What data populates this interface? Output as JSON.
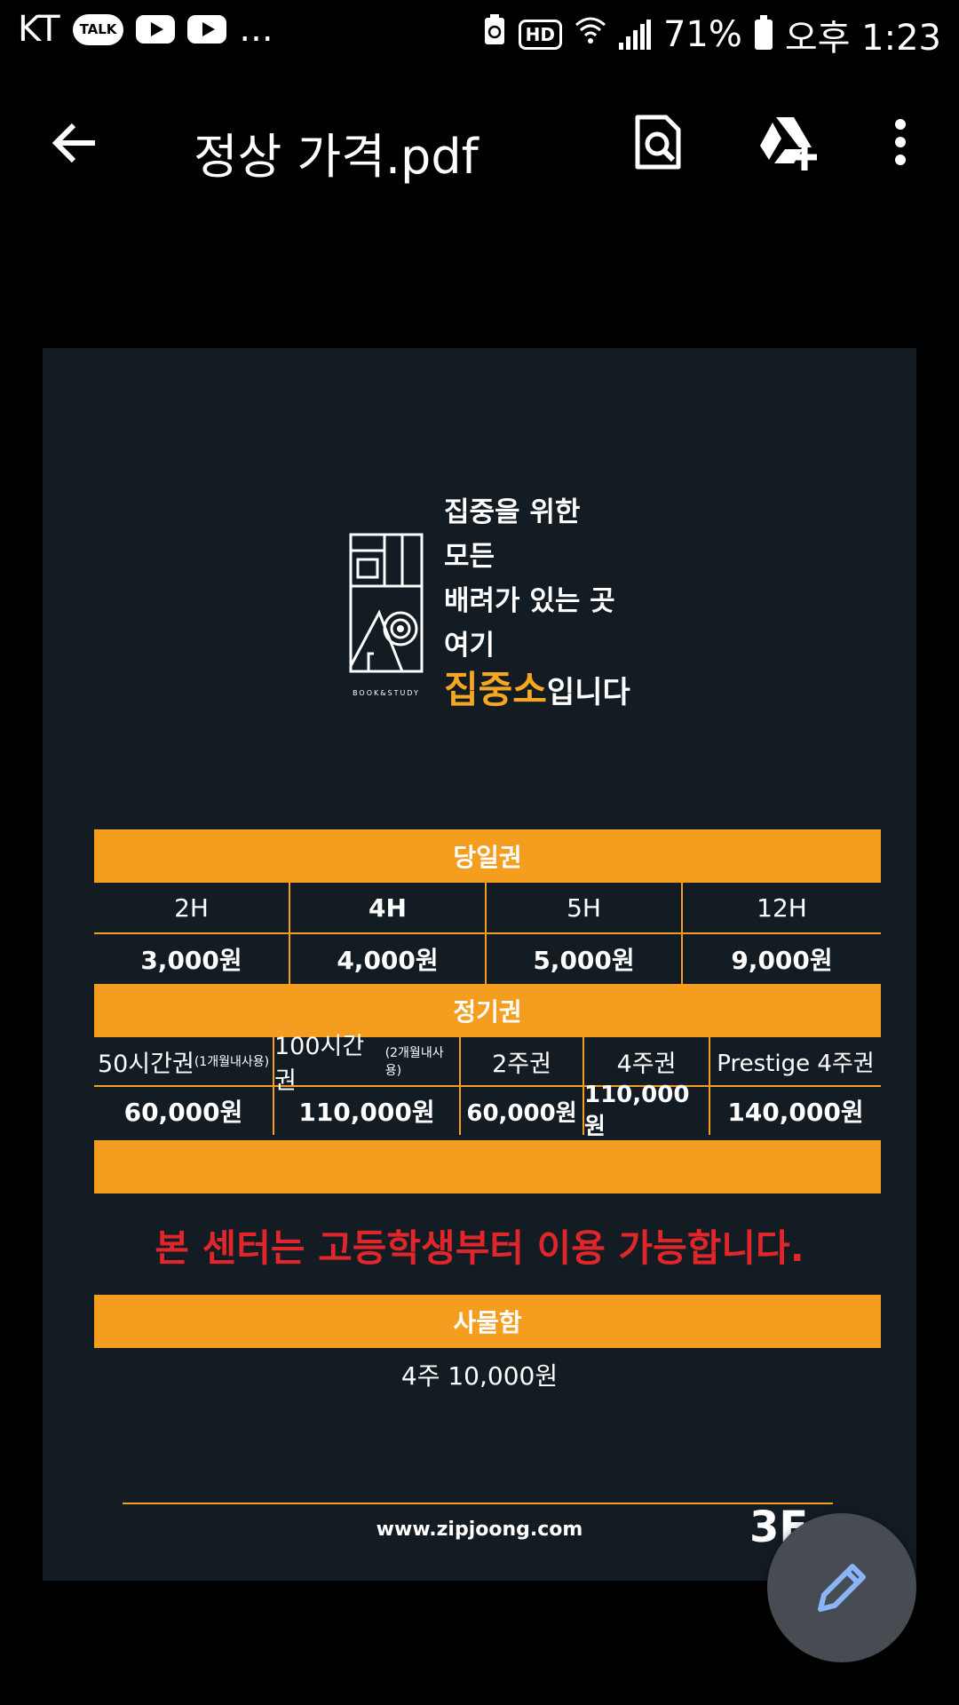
{
  "status_bar": {
    "carrier": "KT",
    "talk_badge": "TALK",
    "more": "...",
    "hd": "HD",
    "battery": "71%",
    "time": "오후 1:23"
  },
  "toolbar": {
    "title": "정상 가격.pdf"
  },
  "document": {
    "logo_caption": "BOOK&STUDY",
    "slogan_lines": [
      "집중을 위한",
      "모든",
      "배려가 있는 곳",
      "여기"
    ],
    "slogan_highlight": "집중소",
    "slogan_tail": "입니다",
    "day_pass": {
      "header": "당일권",
      "durations": [
        "2H",
        "4H",
        "5H",
        "12H"
      ],
      "prices": [
        "3,000원",
        "4,000원",
        "5,000원",
        "9,000원"
      ]
    },
    "regular_pass": {
      "header": "정기권",
      "items": [
        {
          "name": "50시간권",
          "note": "(1개월내사용)",
          "price": "60,000원"
        },
        {
          "name": "100시간권",
          "note": "(2개월내사용)",
          "price": "110,000원"
        },
        {
          "name": "2주권",
          "note": "",
          "price": "60,000원"
        },
        {
          "name": "4주권",
          "note": "",
          "price": "110,000원"
        },
        {
          "name": "Prestige 4주권",
          "note": "",
          "price": "140,000원"
        }
      ]
    },
    "notice": "본 센터는 고등학생부터 이용 가능합니다.",
    "locker": {
      "header": "사물함",
      "price": "4주 10,000원"
    },
    "website": "www.zipjoong.com",
    "floor": "3F"
  },
  "colors": {
    "accent": "#f49d1e",
    "page_bg": "#141c23",
    "notice": "#e0262a",
    "fab": "#474c52"
  }
}
